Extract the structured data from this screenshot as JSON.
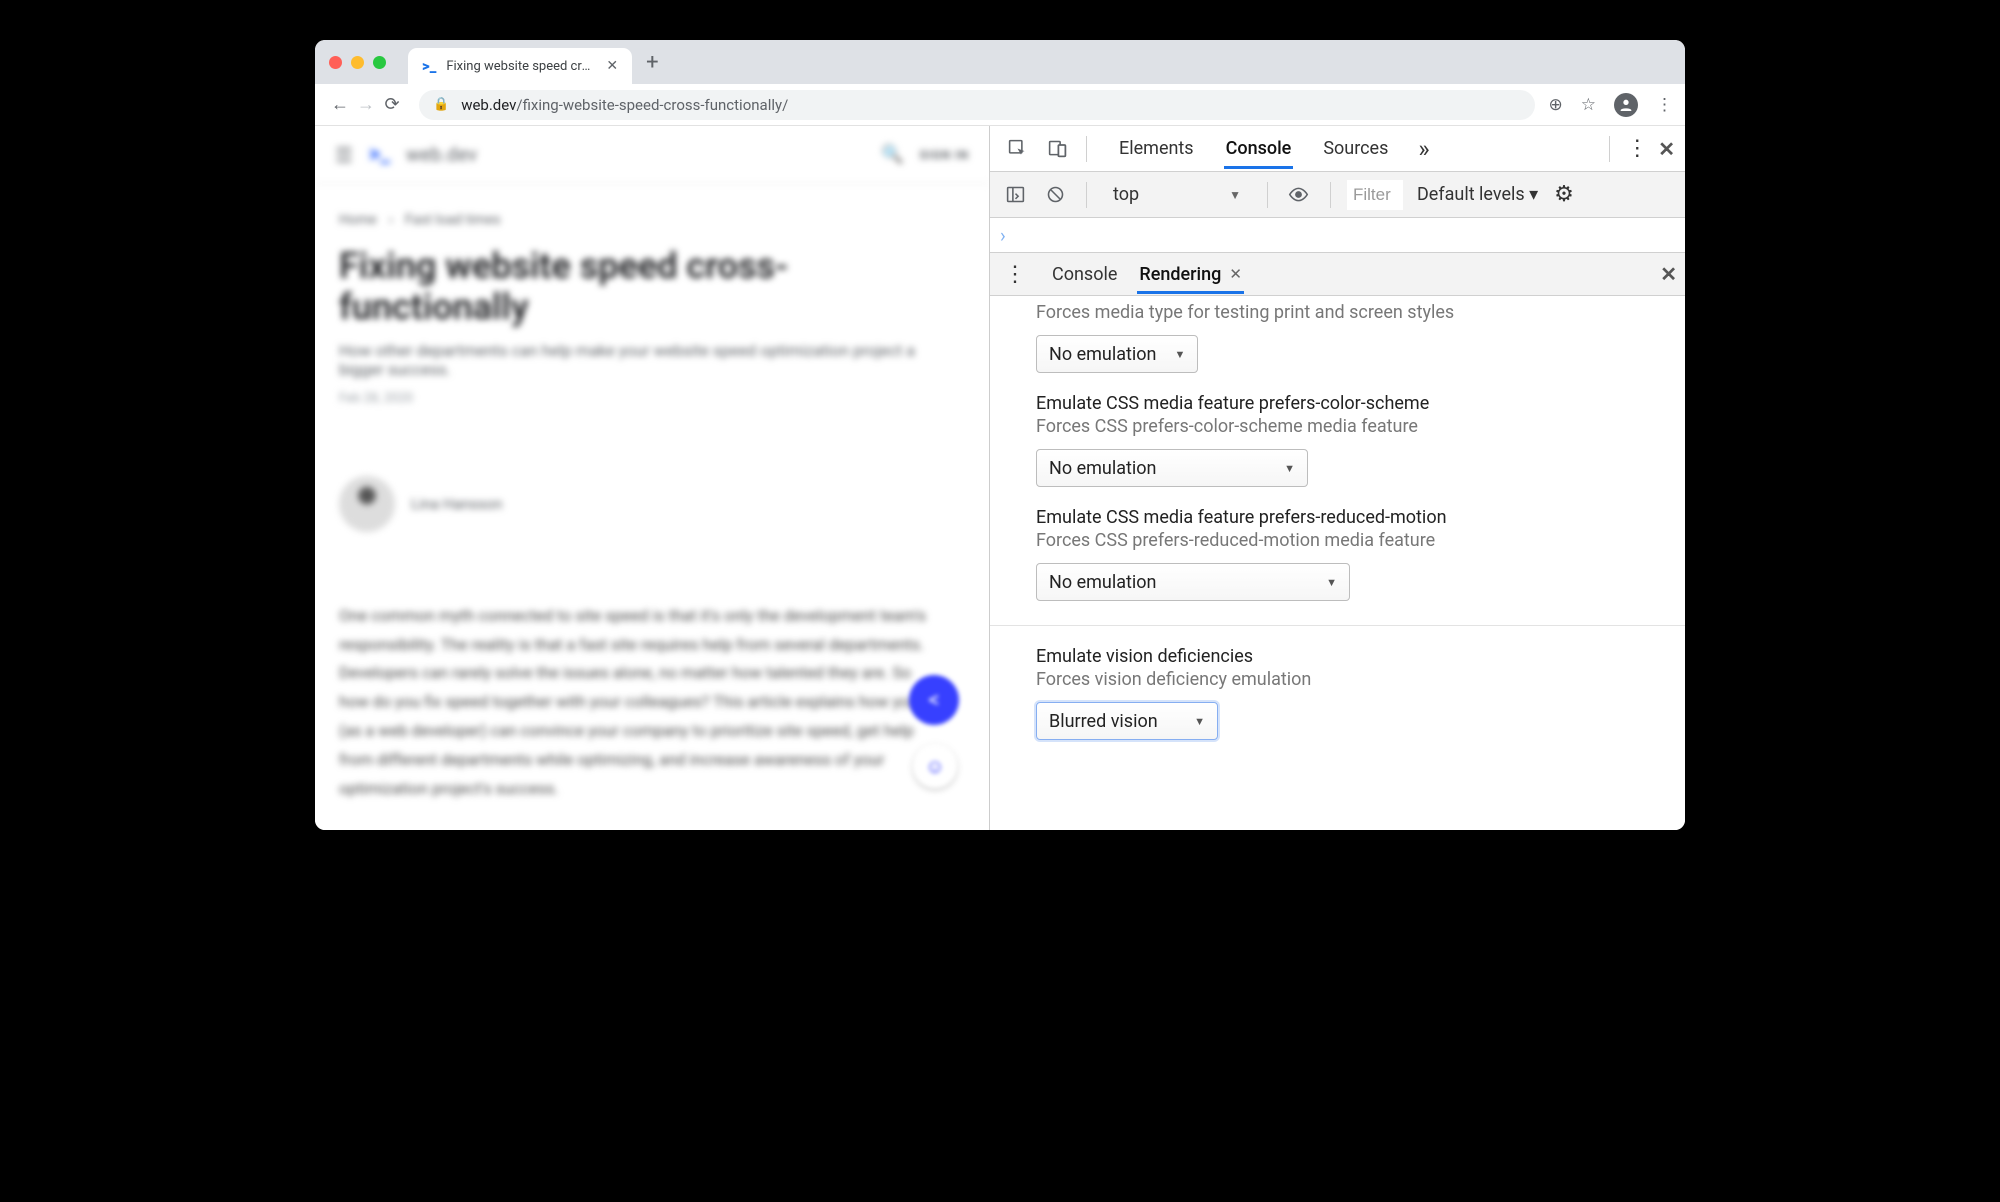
{
  "browser": {
    "tab_title": "Fixing website speed cross-functionally",
    "url_host": "web.dev",
    "url_path": "/fixing-website-speed-cross-functionally/"
  },
  "page": {
    "brand": "web.dev",
    "signin": "SIGN IN",
    "breadcrumbs": [
      "Home",
      "Fast load times"
    ],
    "title": "Fixing website speed cross-functionally",
    "subtitle": "How other departments can help make your website speed optimization project a bigger success.",
    "date": "Feb 28, 2020",
    "author": "Lina Hansson",
    "body": "One common myth connected to site speed is that it's only the development team's responsibility. The reality is that a fast site requires help from several departments. Developers can rarely solve the issues alone, no matter how talented they are. So how do you fix speed together with your colleagues? This article explains how you (as a web developer) can convince your company to prioritize site speed, get help from different departments while optimizing, and increase awareness of your optimization project's success."
  },
  "devtools": {
    "tabs": {
      "elements": "Elements",
      "console": "Console",
      "sources": "Sources"
    },
    "toolbar": {
      "context": "top",
      "filter_placeholder": "Filter",
      "levels": "Default levels ▾"
    },
    "drawer": {
      "console": "Console",
      "rendering": "Rendering"
    },
    "rendering": {
      "media_type": {
        "sub": "Forces media type for testing print and screen styles",
        "value": "No emulation"
      },
      "color_scheme": {
        "title": "Emulate CSS media feature prefers-color-scheme",
        "sub": "Forces CSS prefers-color-scheme media feature",
        "value": "No emulation"
      },
      "reduced_motion": {
        "title": "Emulate CSS media feature prefers-reduced-motion",
        "sub": "Forces CSS prefers-reduced-motion media feature",
        "value": "No emulation"
      },
      "vision": {
        "title": "Emulate vision deficiencies",
        "sub": "Forces vision deficiency emulation",
        "value": "Blurred vision"
      }
    }
  }
}
